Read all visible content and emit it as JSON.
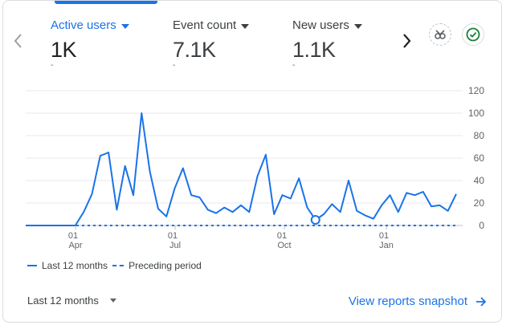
{
  "metrics": [
    {
      "label": "Active users",
      "value": "1K",
      "delta": "-"
    },
    {
      "label": "Event count",
      "value": "7.1K",
      "delta": "-"
    },
    {
      "label": "New users",
      "value": "1.1K",
      "delta": "-"
    }
  ],
  "chart_data": {
    "type": "line",
    "y_ticks": [
      "120",
      "100",
      "80",
      "60",
      "40",
      "20",
      "0"
    ],
    "ylim": [
      0,
      120
    ],
    "x_ticks": [
      {
        "day": "01",
        "month": "Apr"
      },
      {
        "day": "01",
        "month": "Jul"
      },
      {
        "day": "01",
        "month": "Oct"
      },
      {
        "day": "01",
        "month": "Jan"
      }
    ],
    "series": [
      {
        "name": "Last 12 months",
        "style": "solid",
        "color": "#1a73e8",
        "values": [
          0,
          0,
          0,
          0,
          0,
          0,
          0,
          12,
          28,
          62,
          65,
          14,
          53,
          27,
          100,
          48,
          15,
          8,
          33,
          51,
          27,
          25,
          14,
          11,
          16,
          12,
          18,
          12,
          44,
          63,
          10,
          27,
          24,
          42,
          16,
          5,
          10,
          19,
          12,
          40,
          13,
          9,
          6,
          18,
          27,
          12,
          29,
          27,
          30,
          17,
          18,
          13,
          28
        ]
      },
      {
        "name": "Preceding period",
        "style": "dashed",
        "color": "#1a73e8",
        "values": [
          0,
          0,
          0,
          0,
          0,
          0,
          0,
          0,
          0,
          0,
          0,
          0,
          0,
          0,
          0,
          0,
          0,
          0,
          0,
          0,
          0,
          0,
          0,
          0,
          0,
          0,
          0,
          0,
          0,
          0,
          0,
          0,
          0,
          0,
          0,
          0,
          0,
          0,
          0,
          0,
          0,
          0,
          0,
          0,
          0,
          0,
          0,
          0,
          0,
          0,
          0,
          0,
          0
        ]
      }
    ],
    "highlight_index": 35,
    "grid": true,
    "legend_position": "bottom-left"
  },
  "footer": {
    "period_label": "Last 12 months",
    "snapshot_label": "View reports snapshot"
  },
  "icons": {
    "prev": "chevron-left-icon",
    "next": "chevron-right-icon",
    "insights": "insights-icon",
    "status": "check-circle-icon"
  },
  "colors": {
    "accent": "#1a73e8",
    "status_green": "#188038"
  }
}
